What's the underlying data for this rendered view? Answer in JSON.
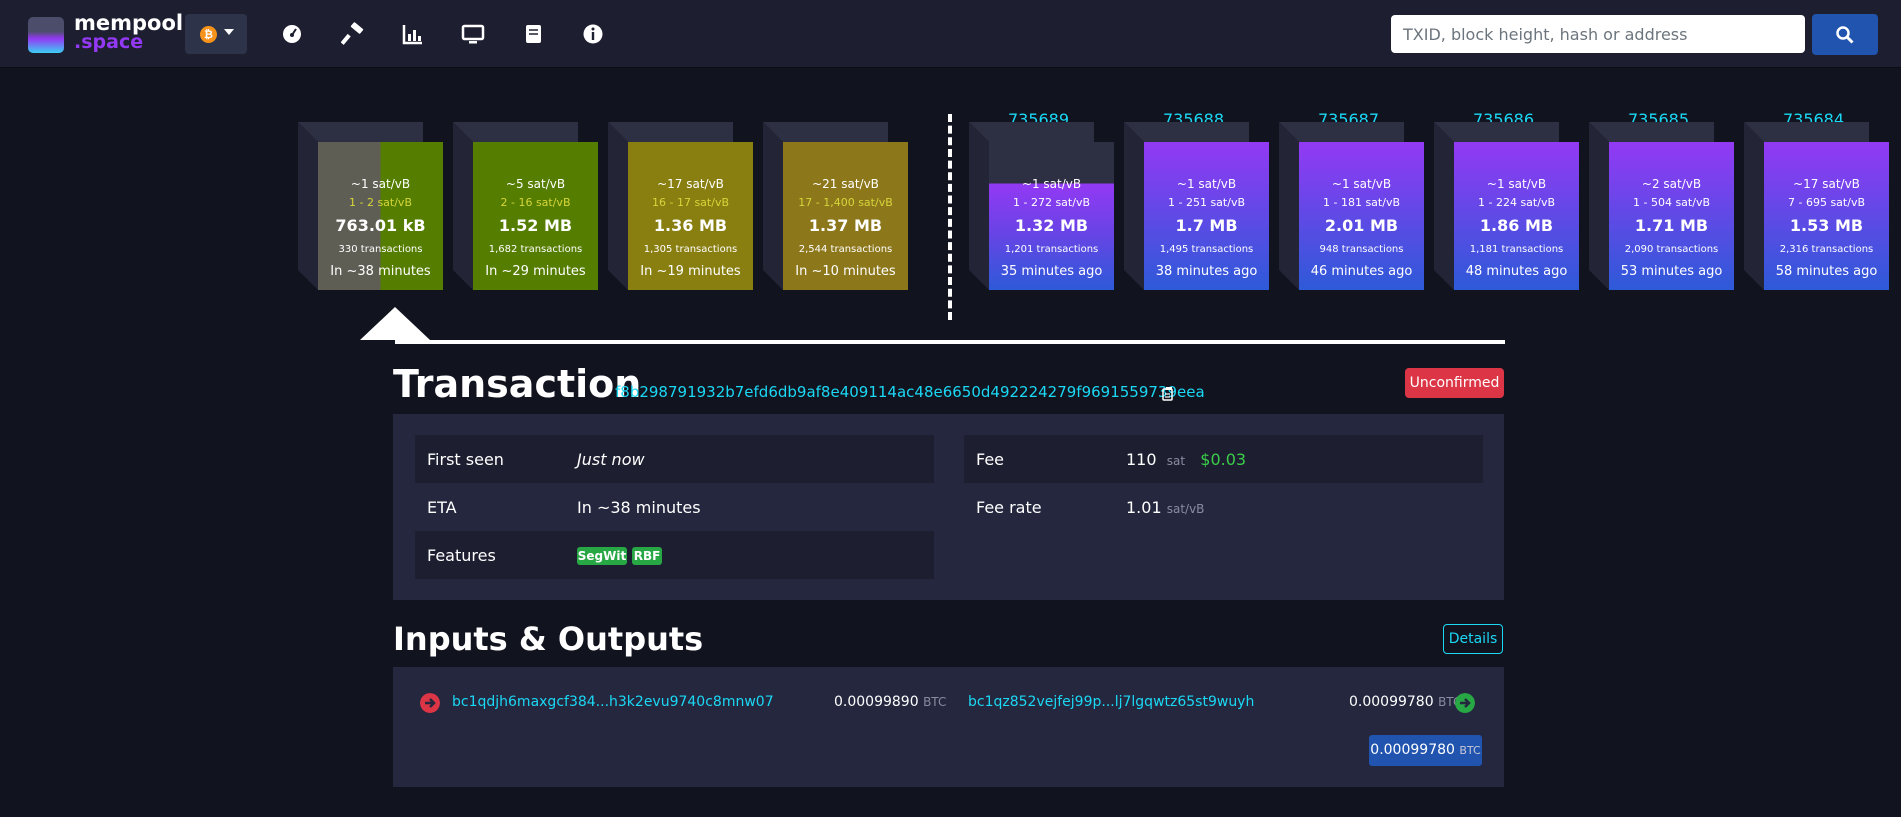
{
  "brand": {
    "line1": "mempool",
    "line2": ".space"
  },
  "nav": {
    "icons": [
      "dashboard-icon",
      "mining-icon",
      "graphs-icon",
      "tv-icon",
      "docs-icon",
      "about-icon"
    ]
  },
  "search": {
    "placeholder": "TXID, block height, hash or address"
  },
  "pending_blocks": [
    {
      "fee": "~1 sat/vB",
      "range": "1 - 2 sat/vB",
      "size": "763.01 kB",
      "txs": "330 transactions",
      "time": "In ~38 minutes"
    },
    {
      "fee": "~5 sat/vB",
      "range": "2 - 16 sat/vB",
      "size": "1.52 MB",
      "txs": "1,682 transactions",
      "time": "In ~29 minutes"
    },
    {
      "fee": "~17 sat/vB",
      "range": "16 - 17 sat/vB",
      "size": "1.36 MB",
      "txs": "1,305 transactions",
      "time": "In ~19 minutes"
    },
    {
      "fee": "~21 sat/vB",
      "range": "17 - 1,400 sat/vB",
      "size": "1.37 MB",
      "txs": "2,544 transactions",
      "time": "In ~10 minutes"
    }
  ],
  "mined_blocks": [
    {
      "height": "735689",
      "fee": "~1 sat/vB",
      "range": "1 - 272 sat/vB",
      "size": "1.32 MB",
      "txs": "1,201 transactions",
      "time": "35 minutes ago"
    },
    {
      "height": "735688",
      "fee": "~1 sat/vB",
      "range": "1 - 251 sat/vB",
      "size": "1.7 MB",
      "txs": "1,495 transactions",
      "time": "38 minutes ago"
    },
    {
      "height": "735687",
      "fee": "~1 sat/vB",
      "range": "1 - 181 sat/vB",
      "size": "2.01 MB",
      "txs": "948 transactions",
      "time": "46 minutes ago"
    },
    {
      "height": "735686",
      "fee": "~1 sat/vB",
      "range": "1 - 224 sat/vB",
      "size": "1.86 MB",
      "txs": "1,181 transactions",
      "time": "48 minutes ago"
    },
    {
      "height": "735685",
      "fee": "~2 sat/vB",
      "range": "1 - 504 sat/vB",
      "size": "1.71 MB",
      "txs": "2,090 transactions",
      "time": "53 minutes ago"
    },
    {
      "height": "735684",
      "fee": "~17 sat/vB",
      "range": "7 - 695 sat/vB",
      "size": "1.53 MB",
      "txs": "2,316 transactions",
      "time": "58 minutes ago"
    }
  ],
  "transaction": {
    "title": "Transaction",
    "txid": "f8b298791932b7efd6db9af8e409114ac48e6650d492224279f9691559739eea",
    "status": "Unconfirmed",
    "first_seen_label": "First seen",
    "first_seen_value": "Just now",
    "eta_label": "ETA",
    "eta_value": "In ~38 minutes",
    "features_label": "Features",
    "features": [
      "SegWit",
      "RBF"
    ],
    "fee_label": "Fee",
    "fee_value": "110",
    "fee_unit": "sat",
    "fee_fiat": "$0.03",
    "fee_rate_label": "Fee rate",
    "fee_rate_value": "1.01",
    "fee_rate_unit": "sat/vB"
  },
  "io": {
    "title": "Inputs & Outputs",
    "details_label": "Details",
    "input_address": "bc1qdjh6maxgcf384...h3k2evu9740c8mnw07",
    "input_amount": "0.00099890",
    "output_address": "bc1qz852vejfej99p...lj7lgqwtz65st9wuyh",
    "output_amount": "0.00099780",
    "unit": "BTC",
    "total": "0.00099780",
    "colors": {
      "input": "#dc3545",
      "output": "#28a745"
    }
  }
}
